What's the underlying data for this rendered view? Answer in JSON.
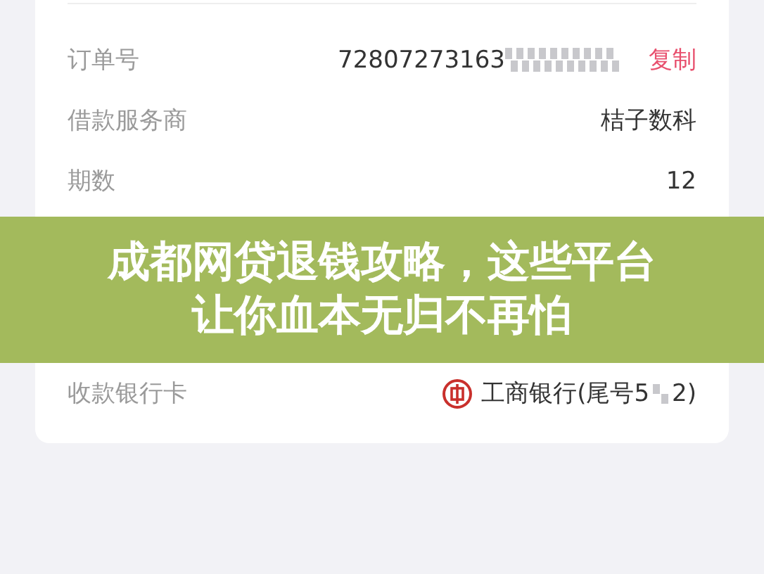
{
  "order_details": {
    "rows": [
      {
        "label": "订单号",
        "value": "72807273163",
        "masked": true,
        "action": "复制"
      },
      {
        "label": "借款服务商",
        "value": "桔子数科"
      },
      {
        "label": "期数",
        "value": "12"
      }
    ]
  },
  "banner": {
    "lines": [
      "成都网贷退钱攻略，这些平台",
      "让你血本无归不再怕"
    ]
  },
  "payout": {
    "rows": [
      {
        "kind": "bank",
        "label": "收款银行卡",
        "value": "工商银行(尾号5",
        "masked": true,
        "value_suffix": "2)"
      }
    ]
  }
}
